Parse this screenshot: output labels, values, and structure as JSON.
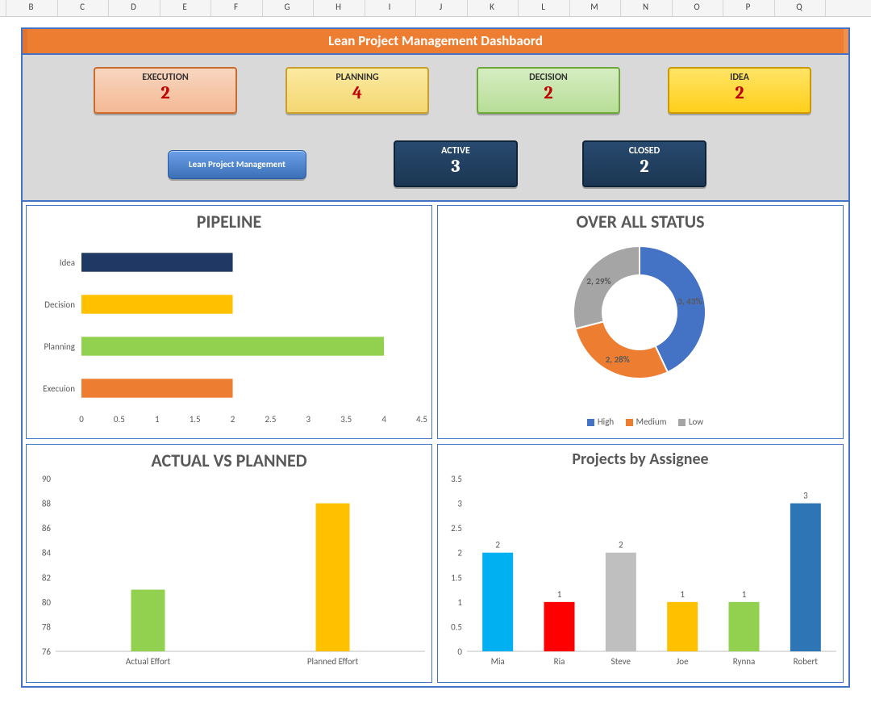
{
  "columns": [
    "B",
    "C",
    "D",
    "E",
    "F",
    "G",
    "H",
    "I",
    "J",
    "K",
    "L",
    "M",
    "N",
    "O",
    "P",
    "Q"
  ],
  "titlebar": "Lean Project Management Dashbaord",
  "cards": {
    "execution": {
      "label": "EXECUTION",
      "value": "2"
    },
    "planning": {
      "label": "PLANNING",
      "value": "4"
    },
    "decision": {
      "label": "DECISION",
      "value": "2"
    },
    "idea": {
      "label": "IDEA",
      "value": "2"
    },
    "active": {
      "label": "ACTIVE",
      "value": "3"
    },
    "closed": {
      "label": "CLOSED",
      "value": "2"
    }
  },
  "lean_btn": "Lean Project Management",
  "pipeline": {
    "title": "PIPELINE",
    "cats": [
      "Idea",
      "Decision",
      "Planning",
      "Execuion"
    ],
    "vals": [
      2,
      2,
      4,
      2
    ],
    "colors": [
      "#1f3864",
      "#ffc000",
      "#92d050",
      "#ed7d31"
    ],
    "ticks": [
      0,
      0.5,
      1,
      1.5,
      2,
      2.5,
      3,
      3.5,
      4,
      4.5
    ]
  },
  "overall": {
    "title": "OVER ALL  STATUS",
    "legend": [
      "High",
      "Medium",
      "Low"
    ],
    "colors": [
      "#4472c4",
      "#ed7d31",
      "#a5a5a5"
    ],
    "labels": [
      "3, 43%",
      "2, 28%",
      "2, 29%"
    ],
    "vals": [
      43,
      28,
      29
    ],
    "label_high": "3, 43%",
    "label_med": "2, 28%",
    "label_low": "2, 29%"
  },
  "avp": {
    "title": "ACTUAL VS PLANNED",
    "cats": [
      "Actual Effort",
      "Planned Effort"
    ],
    "vals": [
      81,
      88
    ],
    "colors": [
      "#92d050",
      "#ffc000"
    ],
    "ticks": [
      76,
      78,
      80,
      82,
      84,
      86,
      88,
      90
    ]
  },
  "assignee": {
    "title": "Projects by Assignee",
    "cats": [
      "Mia",
      "Ria",
      "Steve",
      "Joe",
      "Rynna",
      "Robert"
    ],
    "vals": [
      2,
      1,
      2,
      1,
      1,
      3
    ],
    "colors": [
      "#00b0f0",
      "#ff0000",
      "#bfbfbf",
      "#ffc000",
      "#92d050",
      "#2e75b6"
    ],
    "ticks": [
      0,
      0.5,
      1,
      1.5,
      2,
      2.5,
      3,
      3.5
    ]
  },
  "legend_high": "High",
  "legend_med": "Medium",
  "legend_low": "Low",
  "chart_data": [
    {
      "type": "bar",
      "orientation": "horizontal",
      "title": "PIPELINE",
      "categories": [
        "Idea",
        "Decision",
        "Planning",
        "Execuion"
      ],
      "values": [
        2,
        2,
        4,
        2
      ],
      "xlim": [
        0,
        4.5
      ]
    },
    {
      "type": "pie",
      "title": "OVER ALL  STATUS",
      "series": [
        {
          "name": "High",
          "value": 3,
          "percent": 43
        },
        {
          "name": "Medium",
          "value": 2,
          "percent": 28
        },
        {
          "name": "Low",
          "value": 2,
          "percent": 29
        }
      ]
    },
    {
      "type": "bar",
      "title": "ACTUAL VS PLANNED",
      "categories": [
        "Actual Effort",
        "Planned Effort"
      ],
      "values": [
        81,
        88
      ],
      "ylim": [
        76,
        90
      ]
    },
    {
      "type": "bar",
      "title": "Projects by Assignee",
      "categories": [
        "Mia",
        "Ria",
        "Steve",
        "Joe",
        "Rynna",
        "Robert"
      ],
      "values": [
        2,
        1,
        2,
        1,
        1,
        3
      ],
      "ylim": [
        0,
        3.5
      ]
    }
  ]
}
